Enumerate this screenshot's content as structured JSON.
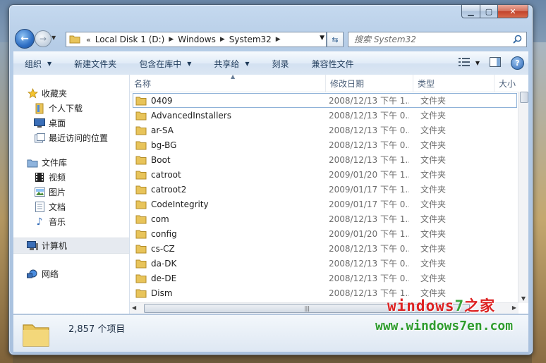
{
  "address": {
    "history_chevron": "«",
    "crumbs": [
      "Local Disk 1 (D:)",
      "Windows",
      "System32"
    ]
  },
  "search": {
    "placeholder": "搜索 System32"
  },
  "toolbar": {
    "organize": "组织",
    "new_folder": "新建文件夹",
    "include_library": "包含在库中",
    "share_with": "共享给",
    "burn": "刻录",
    "compat_files": "兼容性文件"
  },
  "nav": {
    "favorites": "收藏夹",
    "downloads": "个人下载",
    "desktop": "桌面",
    "recent": "最近访问的位置",
    "libraries": "文件库",
    "videos": "视频",
    "pictures": "图片",
    "documents": "文档",
    "music": "音乐",
    "computer": "计算机",
    "network": "网络"
  },
  "columns": {
    "name": "名称",
    "date": "修改日期",
    "type": "类型",
    "size": "大小"
  },
  "files": [
    {
      "name": "0409",
      "date": "2008/12/13 下午 1...",
      "type": "文件夹"
    },
    {
      "name": "AdvancedInstallers",
      "date": "2008/12/13 下午 0...",
      "type": "文件夹"
    },
    {
      "name": "ar-SA",
      "date": "2008/12/13 下午 0...",
      "type": "文件夹"
    },
    {
      "name": "bg-BG",
      "date": "2008/12/13 下午 0...",
      "type": "文件夹"
    },
    {
      "name": "Boot",
      "date": "2008/12/13 下午 1...",
      "type": "文件夹"
    },
    {
      "name": "catroot",
      "date": "2009/01/20 下午 1...",
      "type": "文件夹"
    },
    {
      "name": "catroot2",
      "date": "2009/01/17 下午 1...",
      "type": "文件夹"
    },
    {
      "name": "CodeIntegrity",
      "date": "2009/01/17 下午 0...",
      "type": "文件夹"
    },
    {
      "name": "com",
      "date": "2008/12/13 下午 1...",
      "type": "文件夹"
    },
    {
      "name": "config",
      "date": "2009/01/20 下午 1...",
      "type": "文件夹"
    },
    {
      "name": "cs-CZ",
      "date": "2008/12/13 下午 0...",
      "type": "文件夹"
    },
    {
      "name": "da-DK",
      "date": "2008/12/13 下午 0...",
      "type": "文件夹"
    },
    {
      "name": "de-DE",
      "date": "2008/12/13 下午 0...",
      "type": "文件夹"
    },
    {
      "name": "Dism",
      "date": "2008/12/13 下午 1...",
      "type": "文件夹"
    }
  ],
  "status": {
    "item_count": "2,857 个项目"
  },
  "watermark": {
    "brand_a": "windows",
    "brand_num": "7",
    "brand_b": "之家",
    "url": "www.windows7en.com"
  },
  "colors": {
    "accent": "#2f6fc4",
    "folder": "#e8c45a",
    "watermark_red": "#dd2222",
    "watermark_green": "#2e9c2e"
  }
}
